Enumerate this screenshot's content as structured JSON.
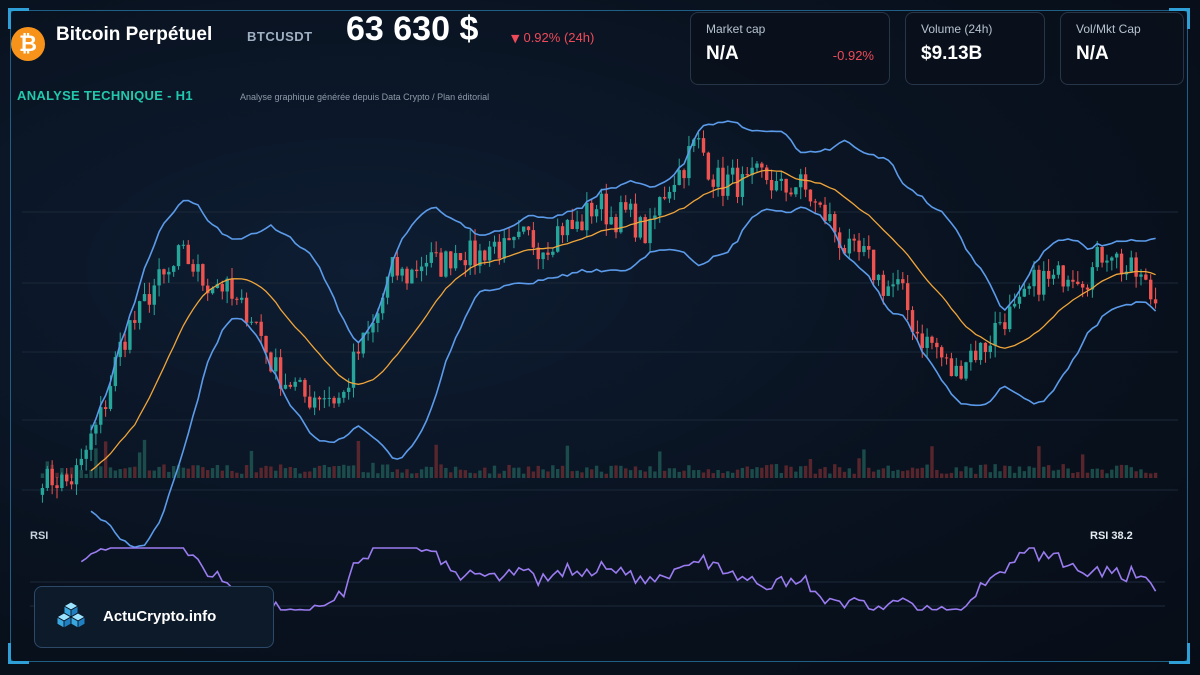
{
  "header": {
    "title": "Bitcoin Perpétuel",
    "ticker": "BTCUSDT",
    "price": "63 630 $",
    "change": "0.92% (24h)"
  },
  "cards": {
    "market_cap": {
      "label": "Market cap",
      "value": "N/A",
      "change": "-0.92%"
    },
    "volume": {
      "label": "Volume (24h)",
      "value": "$9.13B"
    },
    "vol_mkt_cap": {
      "label": "Vol/Mkt Cap",
      "value": "N/A"
    }
  },
  "section": {
    "title": "ANALYSE TECHNIQUE - H1",
    "source": "Analyse graphique générée depuis Data Crypto / Plan éditorial"
  },
  "rsi": {
    "label": "RSI",
    "value_label": "RSI 38.2",
    "value": 38.2
  },
  "brand": {
    "name": "ActuCrypto.info"
  },
  "colors": {
    "up": "#26a69a",
    "down": "#ef5350",
    "bollinger": "#5b9bea",
    "sma": "#f0a53a",
    "rsi": "#9a7cf0",
    "accent": "#22c8ad",
    "negative": "#ef4a5a",
    "bitcoin": "#f7931a"
  },
  "chart_data": {
    "type": "candlestick",
    "interval": "H1",
    "bars": 230,
    "indicators": [
      "Bollinger Bands",
      "SMA",
      "Volume",
      "RSI"
    ],
    "close_path_key": [
      [
        0,
        0.0
      ],
      [
        8,
        0.05
      ],
      [
        18,
        0.48
      ],
      [
        28,
        0.67
      ],
      [
        35,
        0.6
      ],
      [
        42,
        0.52
      ],
      [
        50,
        0.3
      ],
      [
        58,
        0.26
      ],
      [
        62,
        0.28
      ],
      [
        72,
        0.62
      ],
      [
        85,
        0.68
      ],
      [
        95,
        0.7
      ],
      [
        105,
        0.73
      ],
      [
        115,
        0.82
      ],
      [
        125,
        0.75
      ],
      [
        130,
        0.92
      ],
      [
        135,
        1.0
      ],
      [
        140,
        0.88
      ],
      [
        147,
        0.9
      ],
      [
        158,
        0.86
      ],
      [
        163,
        0.74
      ],
      [
        168,
        0.67
      ],
      [
        176,
        0.57
      ],
      [
        182,
        0.42
      ],
      [
        188,
        0.34
      ],
      [
        196,
        0.46
      ],
      [
        206,
        0.61
      ],
      [
        216,
        0.64
      ],
      [
        220,
        0.7
      ],
      [
        224,
        0.62
      ],
      [
        229,
        0.56
      ]
    ],
    "rsi_last": 38.2
  }
}
